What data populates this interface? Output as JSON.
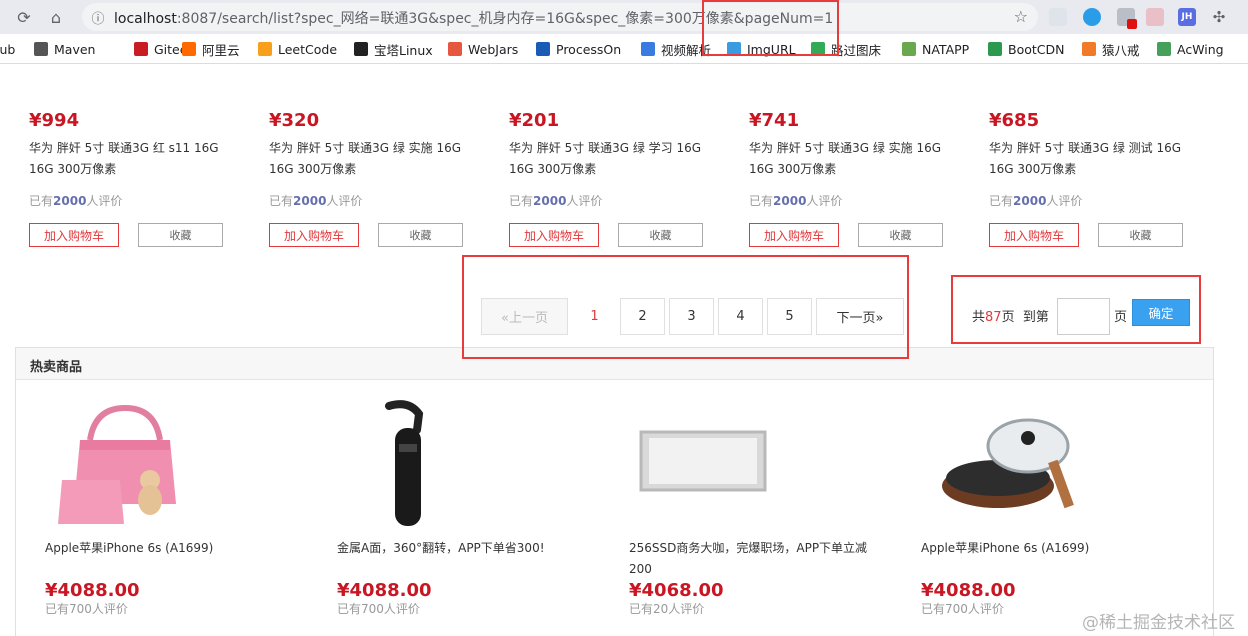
{
  "browser": {
    "url_host": "localhost",
    "url_path": ":8087/search/list?spec_网络=联通3G&spec_机身内存=16G&spec_像素=300万像素&pageNum=1",
    "bookmarks": [
      {
        "label": "lub",
        "icon": "github-icon",
        "color": "#333333"
      },
      {
        "label": "Maven",
        "icon": "maven-icon",
        "color": "#555555"
      },
      {
        "label": "Gitee",
        "icon": "gitee-icon",
        "color": "#c71d23"
      },
      {
        "label": "阿里云",
        "icon": "aliyun-icon",
        "color": "#ff6a00"
      },
      {
        "label": "LeetCode",
        "icon": "leetcode-icon",
        "color": "#f89f1b"
      },
      {
        "label": "宝塔Linux",
        "icon": "bt-icon",
        "color": "#222222"
      },
      {
        "label": "WebJars",
        "icon": "webjars-icon",
        "color": "#e5573f"
      },
      {
        "label": "ProcessOn",
        "icon": "processon-icon",
        "color": "#1a5bb5"
      },
      {
        "label": "视频解析",
        "icon": "video-icon",
        "color": "#3a7be0"
      },
      {
        "label": "ImgURL",
        "icon": "imgurl-icon",
        "color": "#3b9be0"
      },
      {
        "label": "路过图床",
        "icon": "picbed-icon",
        "color": "#33aa55"
      },
      {
        "label": "NATAPP",
        "icon": "natapp-icon",
        "color": "#6aa84f"
      },
      {
        "label": "BootCDN",
        "icon": "bootcdn-icon",
        "color": "#2b9a4f"
      },
      {
        "label": "猿八戒",
        "icon": "yuanbajie-icon",
        "color": "#f07a28"
      },
      {
        "label": "AcWing",
        "icon": "acwing-icon",
        "color": "#46a05a"
      }
    ]
  },
  "products": [
    {
      "price": "¥994",
      "name": "华为 胖奸 5寸 联通3G 红 s11 16G 16G 300万像素",
      "comment_prefix": "已有",
      "comment_count": "2000",
      "comment_suffix": "人评价",
      "cart_label": "加入购物车",
      "fav_label": "收藏"
    },
    {
      "price": "¥320",
      "name": "华为 胖奸 5寸 联通3G 绿 实施 16G 16G 300万像素",
      "comment_prefix": "已有",
      "comment_count": "2000",
      "comment_suffix": "人评价",
      "cart_label": "加入购物车",
      "fav_label": "收藏"
    },
    {
      "price": "¥201",
      "name": "华为 胖奸 5寸 联通3G 绿 学习 16G 16G 300万像素",
      "comment_prefix": "已有",
      "comment_count": "2000",
      "comment_suffix": "人评价",
      "cart_label": "加入购物车",
      "fav_label": "收藏"
    },
    {
      "price": "¥741",
      "name": "华为 胖奸 5寸 联通3G 绿 实施 16G 16G 300万像素",
      "comment_prefix": "已有",
      "comment_count": "2000",
      "comment_suffix": "人评价",
      "cart_label": "加入购物车",
      "fav_label": "收藏"
    },
    {
      "price": "¥685",
      "name": "华为 胖奸 5寸 联通3G 绿 测试 16G 16G 300万像素",
      "comment_prefix": "已有",
      "comment_count": "2000",
      "comment_suffix": "人评价",
      "cart_label": "加入购物车",
      "fav_label": "收藏"
    }
  ],
  "pagination": {
    "prev_label": "«上一页",
    "pages": [
      "1",
      "2",
      "3",
      "4",
      "5"
    ],
    "current": "1",
    "next_label": "下一页»",
    "total_prefix": "共",
    "total_pages": "87",
    "total_suffix": "页  到第",
    "page_suffix": "页",
    "confirm_label": "确定"
  },
  "hot": {
    "title": "热卖商品",
    "items": [
      {
        "name": "Apple苹果iPhone 6s (A1699)",
        "price": "¥4088.00",
        "comment": "已有700人评价",
        "image": "pink-handbag"
      },
      {
        "name": "金属A面，360°翻转，APP下单省300!",
        "price": "¥4088.00",
        "comment": "已有700人评价",
        "image": "bluetooth-earpiece"
      },
      {
        "name": "256SSD商务大咖，完爆职场，APP下单立减200",
        "price": "¥4068.00",
        "comment": "已有20人评价",
        "image": "led-panel"
      },
      {
        "name": "Apple苹果iPhone 6s (A1699)",
        "price": "¥4088.00",
        "comment": "已有700人评价",
        "image": "frying-pan"
      }
    ]
  },
  "watermark": "@稀土掘金技术社区"
}
